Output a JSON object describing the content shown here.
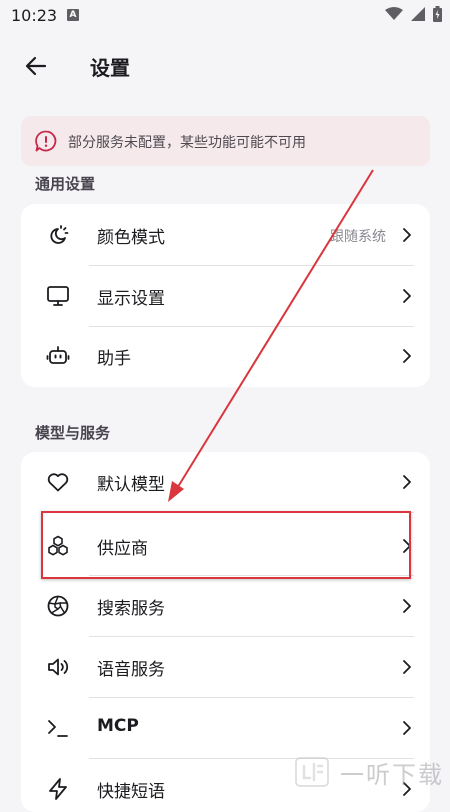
{
  "status_bar": {
    "time": "10:23",
    "notification_icon_letter": "A",
    "icons": [
      "wifi-icon",
      "signal-icon",
      "battery-icon"
    ]
  },
  "app_bar": {
    "title": "设置",
    "back_icon": "arrow-left-icon"
  },
  "warning": {
    "text": "部分服务未配置，某些功能可能不可用",
    "icon": "alert-message-icon",
    "color": "#c62848"
  },
  "general_section": {
    "header": "通用设置",
    "items": [
      {
        "label": "颜色模式",
        "value": "跟随系统",
        "icon": "theme-mode-icon"
      },
      {
        "label": "显示设置",
        "icon": "monitor-icon"
      },
      {
        "label": "助手",
        "icon": "robot-icon"
      }
    ]
  },
  "model_section": {
    "header": "模型与服务",
    "items": [
      {
        "label": "默认模型",
        "icon": "heart-icon"
      },
      {
        "label": "供应商",
        "icon": "cubes-icon"
      },
      {
        "label": "搜索服务",
        "icon": "aperture-icon"
      },
      {
        "label": "语音服务",
        "icon": "speaker-icon"
      },
      {
        "label": "MCP",
        "icon": "terminal-icon"
      },
      {
        "label": "快捷短语",
        "icon": "lightning-icon"
      }
    ]
  },
  "annotation": {
    "color": "#d9363e"
  },
  "watermark": {
    "text": "一听下载"
  }
}
